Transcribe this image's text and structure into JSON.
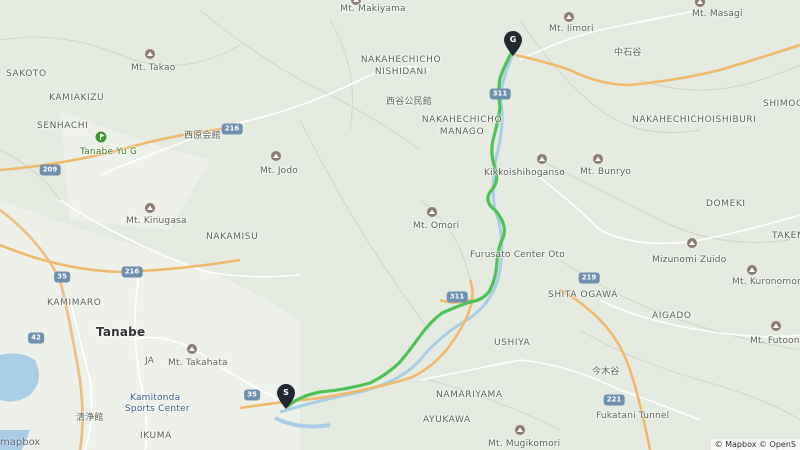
{
  "labels": {
    "mt_makiyama": "Mt. Makiyama",
    "mt_iimori": "Mt. Iimori",
    "mt_masagi": "Mt. Masagi",
    "mt_takao": "Mt. Takao",
    "sakoto": "SAKOTO",
    "kamiakizu": "KAMIAKIZU",
    "senhachi": "SENHACHI",
    "tanabe_yu_g": "Tanabe Yu G",
    "nakahechicho_nishidani_1": "NAKAHECHICHO",
    "nakahechicho_nishidani_2": "NISHIDANI",
    "nishitani_kominkan": "西谷公民館",
    "nakahechicho_manago_1": "NAKAHECHICHO",
    "nakahechicho_manago_2": "MANAGO",
    "nakaishi_dani": "中石谷",
    "nakahechichoishiburi": "NAKAHECHICHOISHIBURI",
    "shimoga": "SHIMOGA",
    "nishihara_kaikan": "西原会館",
    "mt_jodo": "Mt. Jodo",
    "kikkoishihoganso": "Kikkoishihoganso",
    "mt_bunryo": "Mt. Bunryo",
    "mt_kinugasa": "Mt. Kinugasa",
    "domeki": "DOMEKI",
    "mt_omori": "Mt. Omori",
    "furusato_center_oto": "Furusato Center Oto",
    "takeno": "TAKENO",
    "nakamisu": "NAKAMISU",
    "mizunomi_zuido": "Mizunomi Zuido",
    "mt_kuronomori": "Mt. Kuronomori",
    "shita_ogawa": "SHITA OGAWA",
    "kamimaro": "KAMIMARO",
    "tanabe": "Tanabe",
    "aigado": "AIGADO",
    "ja": "JA",
    "mt_takahata": "Mt. Takahata",
    "ushiya": "USHIYA",
    "mt_futoonomori": "Mt. Futoonomori",
    "kamitonda_sports_center_1": "Kamitonda",
    "kamitonda_sports_center_2": "Sports Center",
    "namariyama": "NAMARIYAMA",
    "ayukawa": "AYUKAWA",
    "fukatani_tunnel": "Fukatani Tunnel",
    "kiyomizukan": "清浄館",
    "ikuma": "IKUMA",
    "mt_mugikomori": "Mt. Mugikomori",
    "kiyotani": "今木谷"
  },
  "road_shields": {
    "r216_a": "216",
    "r209": "209",
    "r216_b": "216",
    "r35_a": "35",
    "r42": "42",
    "r35_b": "35",
    "r311_a": "311",
    "r311_b": "311",
    "r219": "219",
    "r221": "221"
  },
  "markers": {
    "start": "S",
    "goal": "G"
  },
  "attribution": {
    "logo": "mapbox",
    "credits": "© Mapbox © OpenS"
  },
  "colors": {
    "route": "#4cc257",
    "major_road": "#f0b86b",
    "minor_road": "#ffffff",
    "water": "#a9cde6",
    "terrain": "#e6ebe1",
    "forest_line": "#cfd6c8",
    "marker": "#222831"
  }
}
